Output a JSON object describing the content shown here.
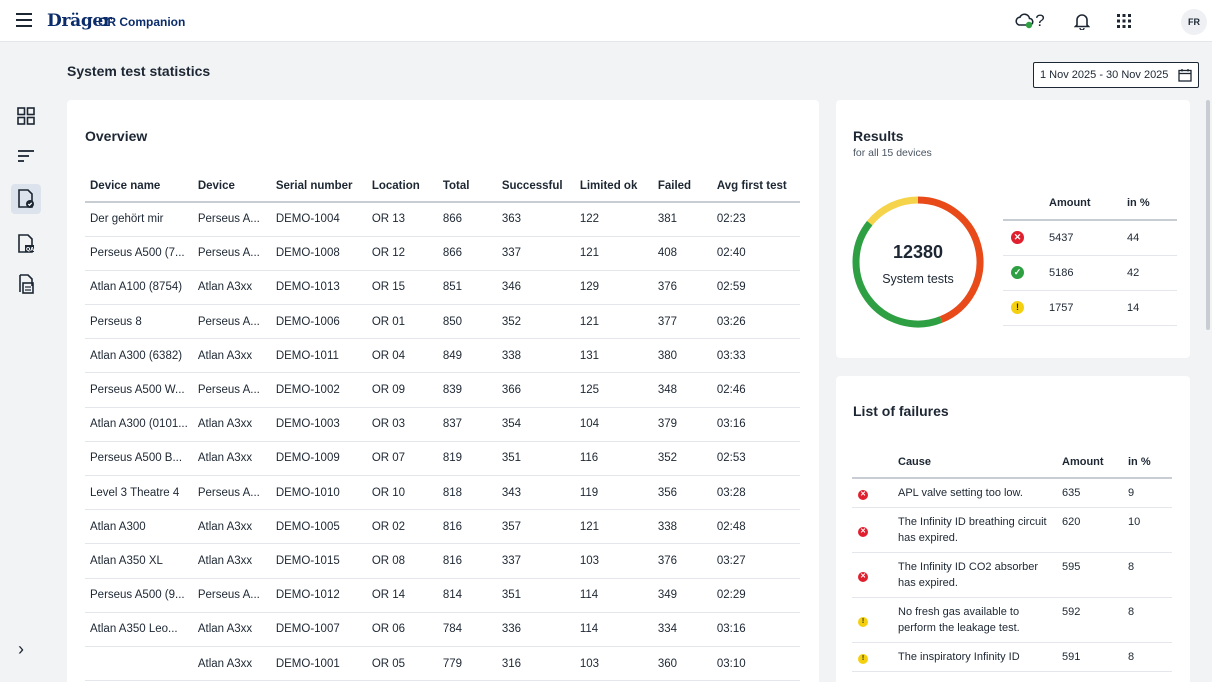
{
  "header": {
    "brand": "Dräger",
    "app_name": "OR Companion",
    "avatar_initials": "FR",
    "help_label": "?"
  },
  "page": {
    "title": "System test statistics",
    "date_range": "1 Nov 2025 - 30 Nov 2025"
  },
  "overview": {
    "title": "Overview",
    "columns": [
      "Device name",
      "Device",
      "Serial number",
      "Location",
      "Total",
      "Successful",
      "Limited ok",
      "Failed",
      "Avg first test"
    ],
    "rows": [
      [
        "Der gehört mir",
        "Perseus A...",
        "DEMO-1004",
        "OR 13",
        "866",
        "363",
        "122",
        "381",
        "02:23"
      ],
      [
        "Perseus A500 (7...",
        "Perseus A...",
        "DEMO-1008",
        "OR 12",
        "866",
        "337",
        "121",
        "408",
        "02:40"
      ],
      [
        "Atlan A100 (8754)",
        "Atlan A3xx",
        "DEMO-1013",
        "OR 15",
        "851",
        "346",
        "129",
        "376",
        "02:59"
      ],
      [
        "Perseus 8",
        "Perseus A...",
        "DEMO-1006",
        "OR 01",
        "850",
        "352",
        "121",
        "377",
        "03:26"
      ],
      [
        "Atlan A300 (6382)",
        "Atlan A3xx",
        "DEMO-1011",
        "OR 04",
        "849",
        "338",
        "131",
        "380",
        "03:33"
      ],
      [
        "Perseus A500 W...",
        "Perseus A...",
        "DEMO-1002",
        "OR 09",
        "839",
        "366",
        "125",
        "348",
        "02:46"
      ],
      [
        "Atlan A300 (0101...",
        "Atlan A3xx",
        "DEMO-1003",
        "OR 03",
        "837",
        "354",
        "104",
        "379",
        "03:16"
      ],
      [
        "Perseus A500 B...",
        "Atlan A3xx",
        "DEMO-1009",
        "OR 07",
        "819",
        "351",
        "116",
        "352",
        "02:53"
      ],
      [
        "Level 3 Theatre 4",
        "Perseus A...",
        "DEMO-1010",
        "OR 10",
        "818",
        "343",
        "119",
        "356",
        "03:28"
      ],
      [
        "Atlan A300",
        "Atlan A3xx",
        "DEMO-1005",
        "OR 02",
        "816",
        "357",
        "121",
        "338",
        "02:48"
      ],
      [
        "Atlan A350 XL",
        "Atlan A3xx",
        "DEMO-1015",
        "OR 08",
        "816",
        "337",
        "103",
        "376",
        "03:27"
      ],
      [
        "Perseus A500 (9...",
        "Perseus A...",
        "DEMO-1012",
        "OR 14",
        "814",
        "351",
        "114",
        "349",
        "02:29"
      ],
      [
        "Atlan A350 Leo...",
        "Atlan A3xx",
        "DEMO-1007",
        "OR 06",
        "784",
        "336",
        "114",
        "334",
        "03:16"
      ],
      [
        "",
        "Atlan A3xx",
        "DEMO-1001",
        "OR 05",
        "779",
        "316",
        "103",
        "360",
        "03:10"
      ]
    ]
  },
  "results": {
    "title": "Results",
    "subtitle": "for all 15 devices",
    "total": "12380",
    "total_label": "System tests",
    "columns": [
      "Amount",
      "in %"
    ],
    "rows": [
      {
        "status": "failed",
        "amount": "5437",
        "percent": "44"
      },
      {
        "status": "successful",
        "amount": "5186",
        "percent": "42"
      },
      {
        "status": "limited",
        "amount": "1757",
        "percent": "14"
      }
    ],
    "colors": {
      "failed": "#e84a1a",
      "successful": "#2ea043",
      "limited": "#f5d34a"
    }
  },
  "failures": {
    "title": "List of failures",
    "columns": [
      "Cause",
      "Amount",
      "in %"
    ],
    "rows": [
      {
        "status": "failed",
        "cause": "APL valve setting too low.",
        "amount": "635",
        "percent": "9"
      },
      {
        "status": "failed",
        "cause": "The Infinity ID breathing circuit has expired.",
        "amount": "620",
        "percent": "10"
      },
      {
        "status": "failed",
        "cause": "The Infinity ID CO2 absorber has expired.",
        "amount": "595",
        "percent": "8"
      },
      {
        "status": "limited",
        "cause": "No fresh gas available to perform the leakage test.",
        "amount": "592",
        "percent": "8"
      },
      {
        "status": "limited",
        "cause": "The inspiratory Infinity ID",
        "amount": "591",
        "percent": "8"
      }
    ]
  }
}
